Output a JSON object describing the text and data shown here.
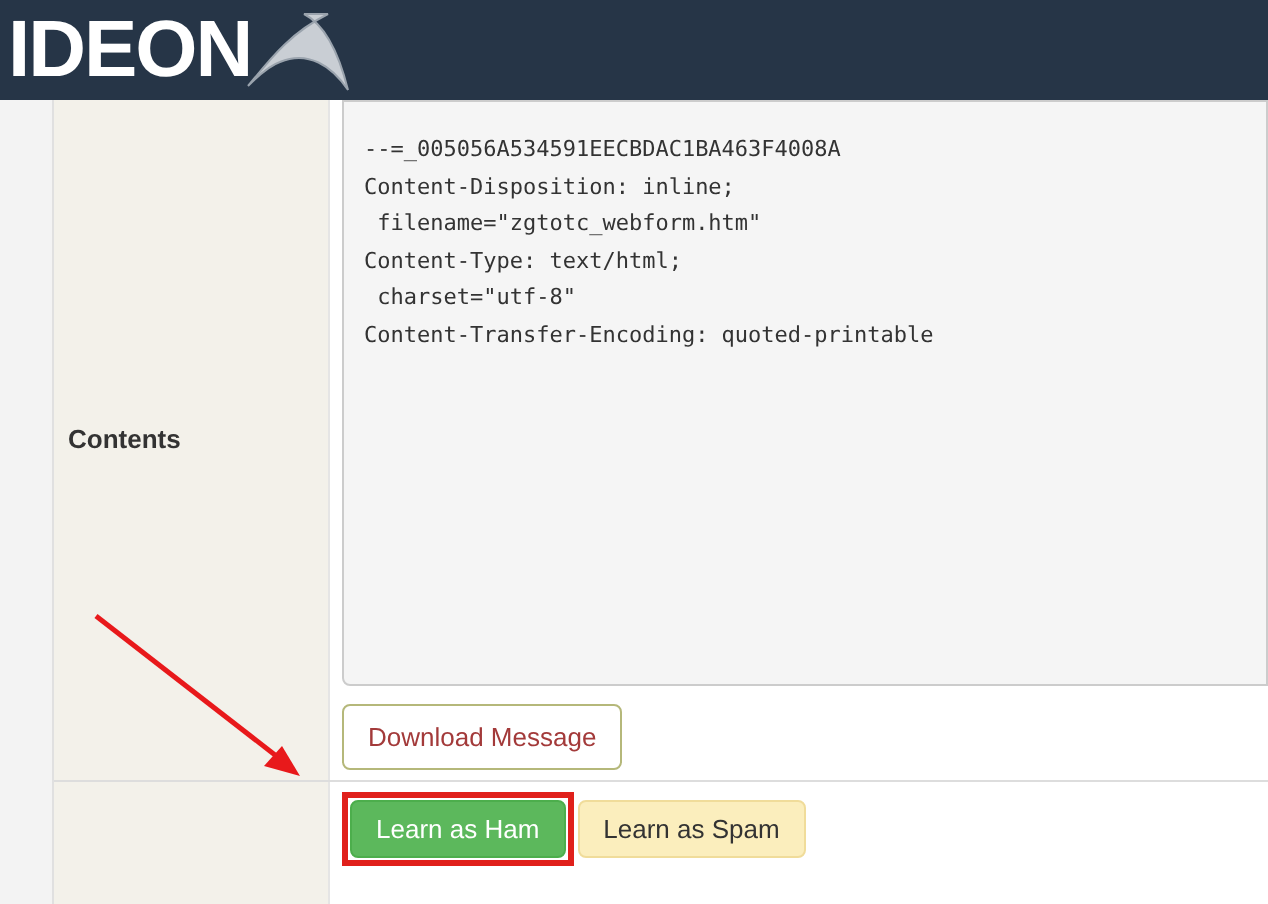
{
  "header": {
    "logo": "IDEON"
  },
  "contents": {
    "label": "Contents",
    "lines": [
      "--=_005056A534591EECBDAC1BA463F4008A",
      "Content-Disposition: inline;",
      " filename=\"zgtotc_webform.htm\"",
      "Content-Type: text/html;",
      " charset=\"utf-8\"",
      "Content-Transfer-Encoding: quoted-printable"
    ]
  },
  "download_button": "Download Message",
  "learn_buttons": [
    {
      "label": "Learn as Ham",
      "kind": "ham",
      "highlighted": true
    },
    {
      "label": "Learn as Spam",
      "kind": "spam",
      "highlighted": false
    }
  ]
}
